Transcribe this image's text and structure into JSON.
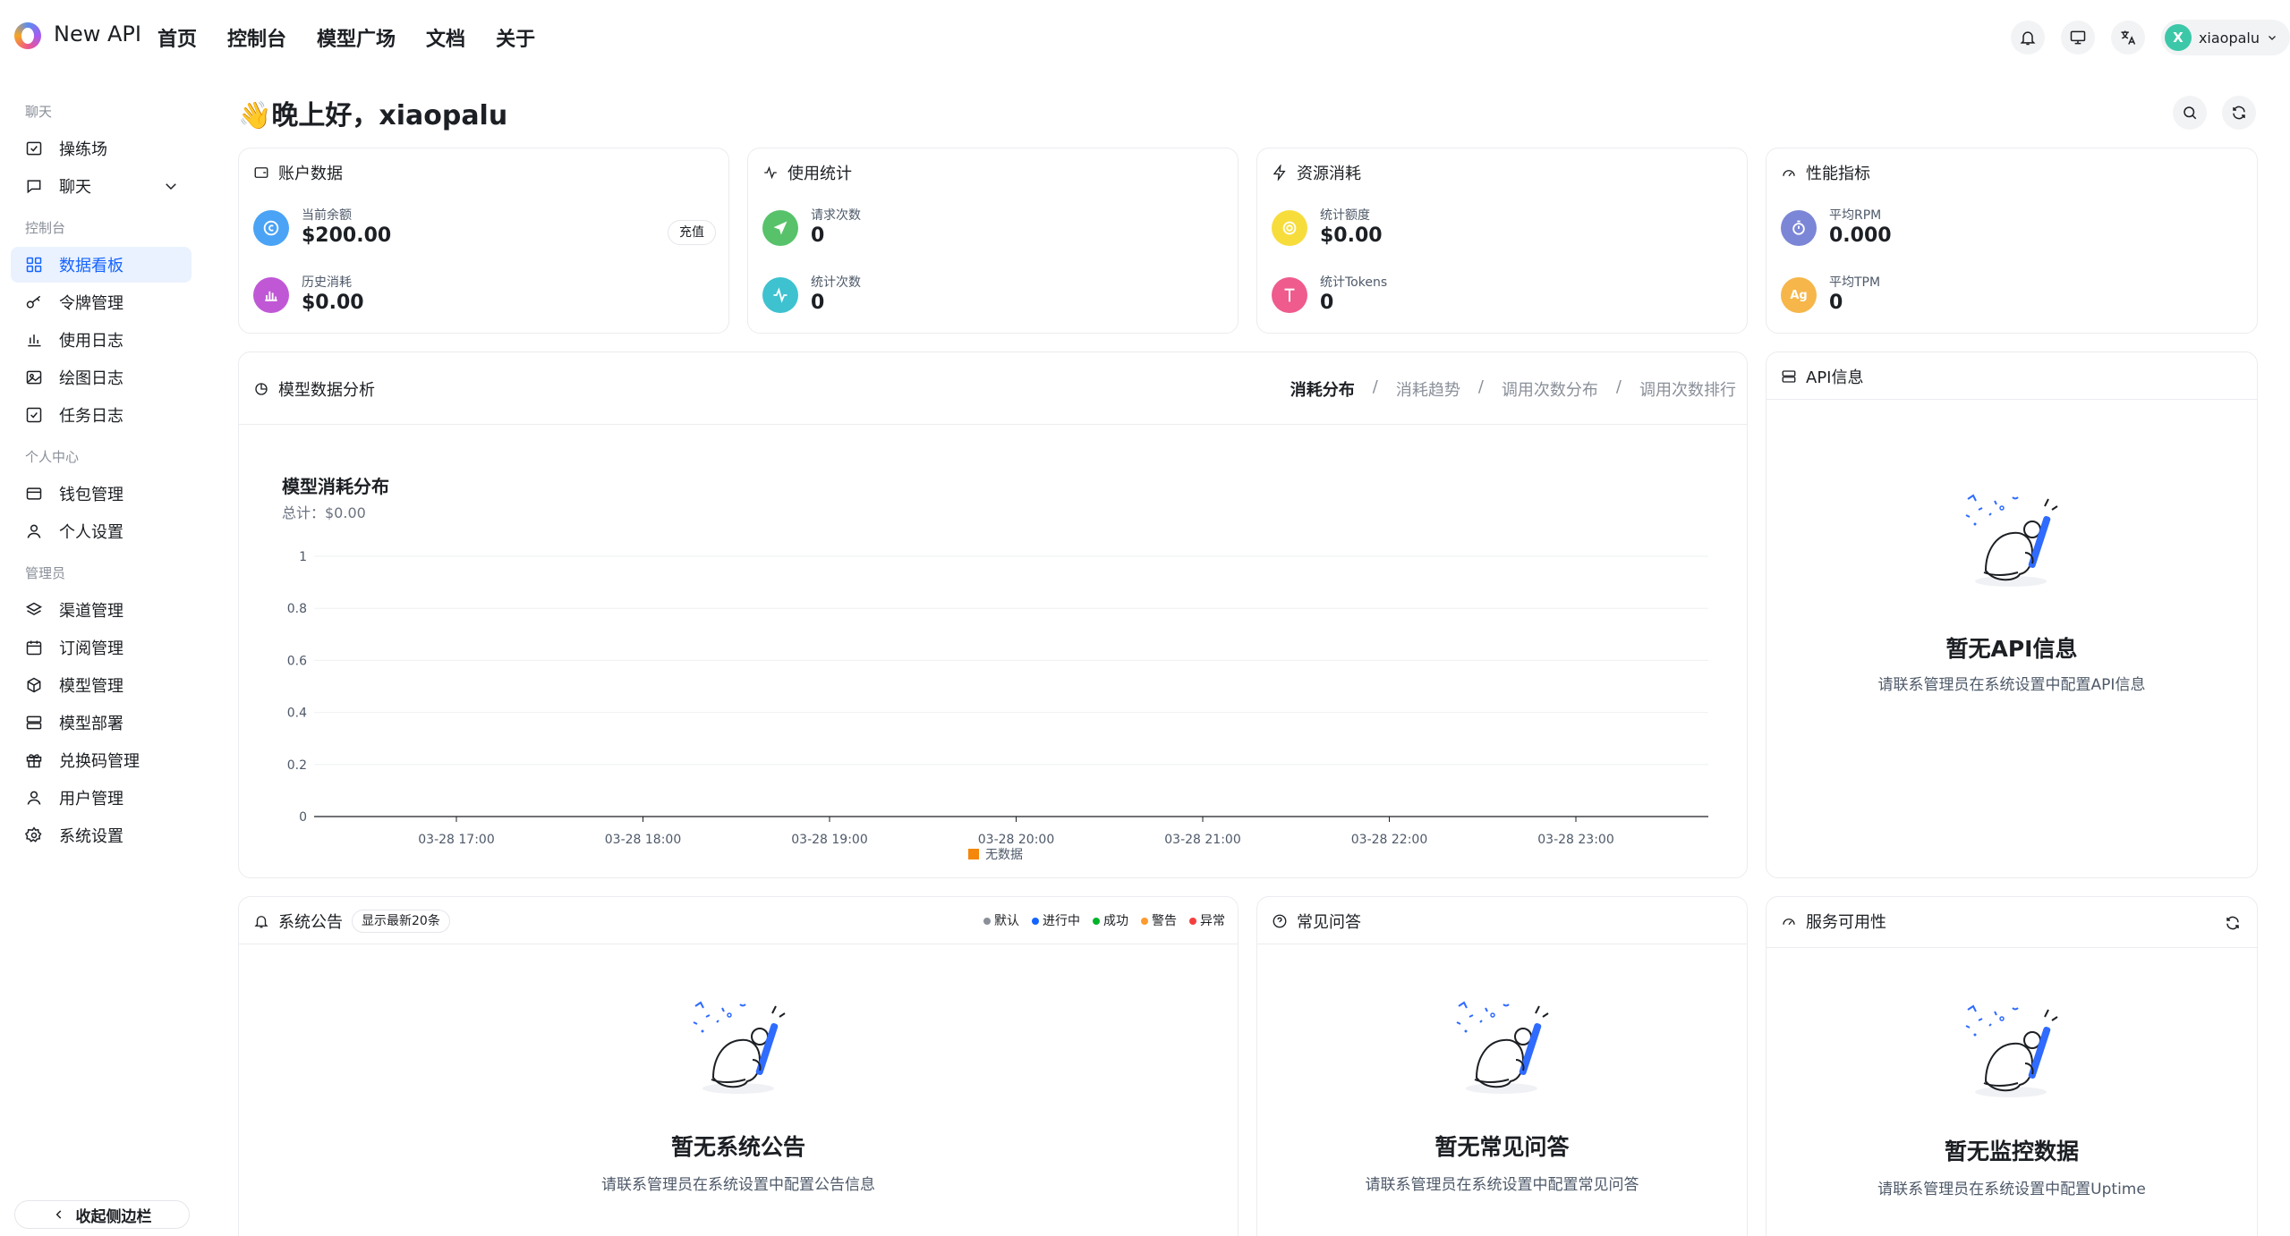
{
  "app": {
    "brand": "New API"
  },
  "topnav": [
    "首页",
    "控制台",
    "模型广场",
    "文档",
    "关于"
  ],
  "user": {
    "initial": "X",
    "name": "xiaopalu"
  },
  "sidebar": {
    "groups": [
      {
        "label": "聊天",
        "items": [
          {
            "label": "操练场",
            "icon": "monitor-icon"
          },
          {
            "label": "聊天",
            "icon": "chat-icon"
          }
        ]
      },
      {
        "label": "控制台",
        "items": [
          {
            "label": "数据看板",
            "icon": "dashboard-icon"
          },
          {
            "label": "令牌管理",
            "icon": "key-icon"
          },
          {
            "label": "使用日志",
            "icon": "bar-chart-icon"
          },
          {
            "label": "绘图日志",
            "icon": "image-icon"
          },
          {
            "label": "任务日志",
            "icon": "checkbox-icon"
          }
        ]
      },
      {
        "label": "个人中心",
        "items": [
          {
            "label": "钱包管理",
            "icon": "wallet-icon"
          },
          {
            "label": "个人设置",
            "icon": "user-icon"
          }
        ]
      },
      {
        "label": "管理员",
        "items": [
          {
            "label": "渠道管理",
            "icon": "layers-icon"
          },
          {
            "label": "订阅管理",
            "icon": "calendar-icon"
          },
          {
            "label": "模型管理",
            "icon": "cube-icon"
          },
          {
            "label": "模型部署",
            "icon": "server-icon"
          },
          {
            "label": "兑换码管理",
            "icon": "gift-icon"
          },
          {
            "label": "用户管理",
            "icon": "user-icon"
          },
          {
            "label": "系统设置",
            "icon": "gear-icon"
          }
        ]
      }
    ],
    "collapse_label": "收起侧边栏"
  },
  "greeting": "👋晚上好，xiaopalu",
  "cards": {
    "account": {
      "title": "账户数据",
      "balance_label": "当前余额",
      "balance_value": "$200.00",
      "recharge": "充值",
      "history_label": "历史消耗",
      "history_value": "$0.00"
    },
    "usage": {
      "title": "使用统计",
      "req_label": "请求次数",
      "req_value": "0",
      "stat_label": "统计次数",
      "stat_value": "0"
    },
    "resource": {
      "title": "资源消耗",
      "quota_label": "统计额度",
      "quota_value": "$0.00",
      "tokens_label": "统计Tokens",
      "tokens_value": "0"
    },
    "perf": {
      "title": "性能指标",
      "rpm_label": "平均RPM",
      "rpm_value": "0.000",
      "tpm_label": "平均TPM",
      "tpm_value": "0"
    }
  },
  "analysis": {
    "title": "模型数据分析",
    "tabs": [
      "消耗分布",
      "消耗趋势",
      "调用次数分布",
      "调用次数排行"
    ]
  },
  "chart_data": {
    "type": "bar",
    "title": "模型消耗分布",
    "subtitle": "总计：$0.00",
    "x": [
      "03-28 17:00",
      "03-28 18:00",
      "03-28 19:00",
      "03-28 20:00",
      "03-28 21:00",
      "03-28 22:00",
      "03-28 23:00"
    ],
    "y_ticks": [
      "1",
      "0.8",
      "0.6",
      "0.4",
      "0.2",
      "0"
    ],
    "ylim": [
      0,
      1
    ],
    "series": [
      {
        "name": "无数据",
        "values": [
          0,
          0,
          0,
          0,
          0,
          0,
          0
        ],
        "color": "#f5870a"
      }
    ],
    "legend": "bottom"
  },
  "api_info": {
    "title": "API信息",
    "empty_title": "暂无API信息",
    "empty_desc": "请联系管理员在系统设置中配置API信息"
  },
  "notice": {
    "title": "系统公告",
    "badge": "显示最新20条",
    "legend": [
      {
        "label": "默认",
        "color": "#8a8f99"
      },
      {
        "label": "进行中",
        "color": "#1664ff"
      },
      {
        "label": "成功",
        "color": "#00b42a"
      },
      {
        "label": "警告",
        "color": "#ff9a2e"
      },
      {
        "label": "异常",
        "color": "#f53f3f"
      }
    ],
    "empty_title": "暂无系统公告",
    "empty_desc": "请联系管理员在系统设置中配置公告信息"
  },
  "faq": {
    "title": "常见问答",
    "empty_title": "暂无常见问答",
    "empty_desc": "请联系管理员在系统设置中配置常见问答"
  },
  "uptime": {
    "title": "服务可用性",
    "empty_title": "暂无监控数据",
    "empty_desc": "请联系管理员在系统设置中配置Uptime"
  },
  "colors": {
    "accent": "#1664ff",
    "active_bg": "#eaf2ff"
  }
}
